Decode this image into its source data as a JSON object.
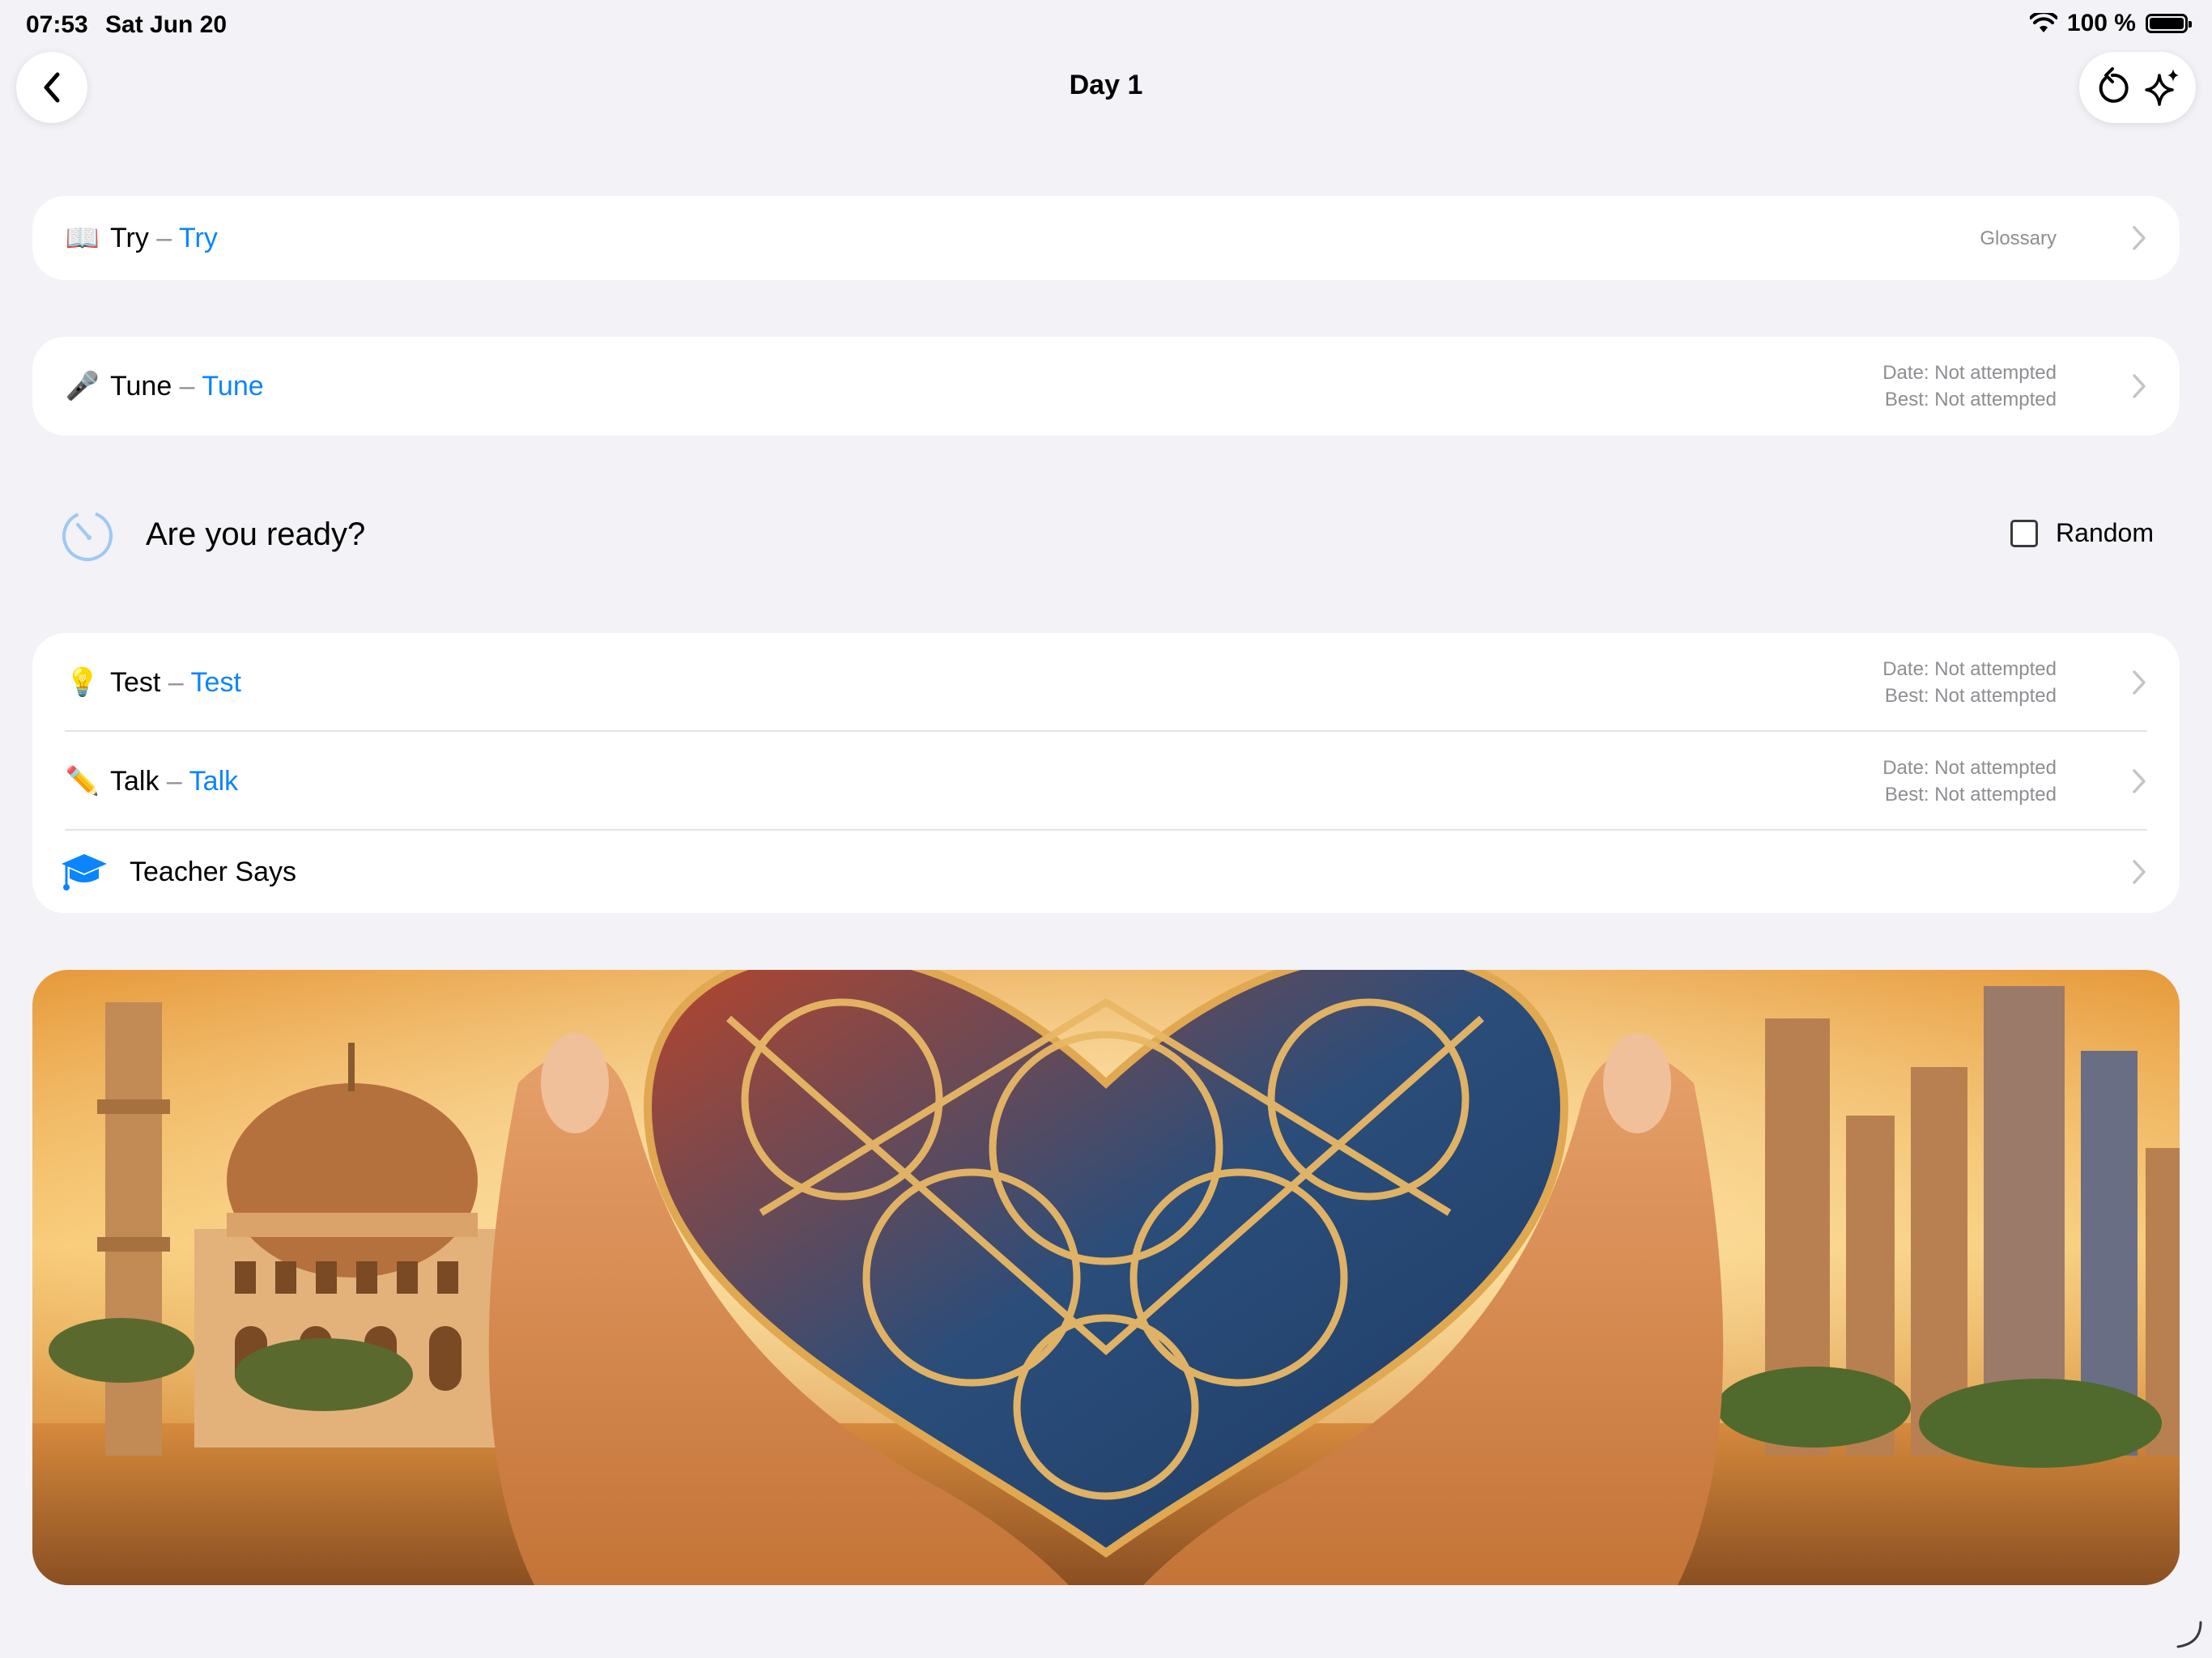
{
  "status_bar": {
    "time": "07:53",
    "date": "Sat Jun 20",
    "battery": "100 %",
    "icons": [
      "wifi-icon",
      "battery-icon"
    ]
  },
  "nav": {
    "title": "Day 1",
    "back_icon": "chevron-left-icon",
    "actions": [
      "reset-icon",
      "sparkles-icon"
    ]
  },
  "glossary_card": {
    "emoji": "📖",
    "title": "Try",
    "dash": " – ",
    "subtitle": "Try",
    "meta": "Glossary"
  },
  "tune_card": {
    "emoji": "🎤",
    "title": "Tune",
    "dash": " – ",
    "subtitle": "Tune",
    "date_line": "Date: Not attempted",
    "best_line": "Best: Not attempted"
  },
  "ready": {
    "text": "Are you ready?",
    "icon": "timer-icon",
    "random_label": "Random",
    "random_checked": false
  },
  "lessons": [
    {
      "emoji": "💡",
      "title": "Test",
      "dash": " – ",
      "subtitle": "Test",
      "date_line": "Date: Not attempted",
      "best_line": "Best: Not attempted"
    },
    {
      "emoji": "✏️",
      "title": "Talk",
      "dash": " – ",
      "subtitle": "Talk",
      "date_line": "Date: Not attempted",
      "best_line": "Best: Not attempted"
    },
    {
      "icon": "graduation-cap-icon",
      "title": "Teacher Says"
    }
  ],
  "colors": {
    "background": "#f2f2f7",
    "accent": "#0a84ff",
    "secondary_text": "#8e8e93"
  }
}
